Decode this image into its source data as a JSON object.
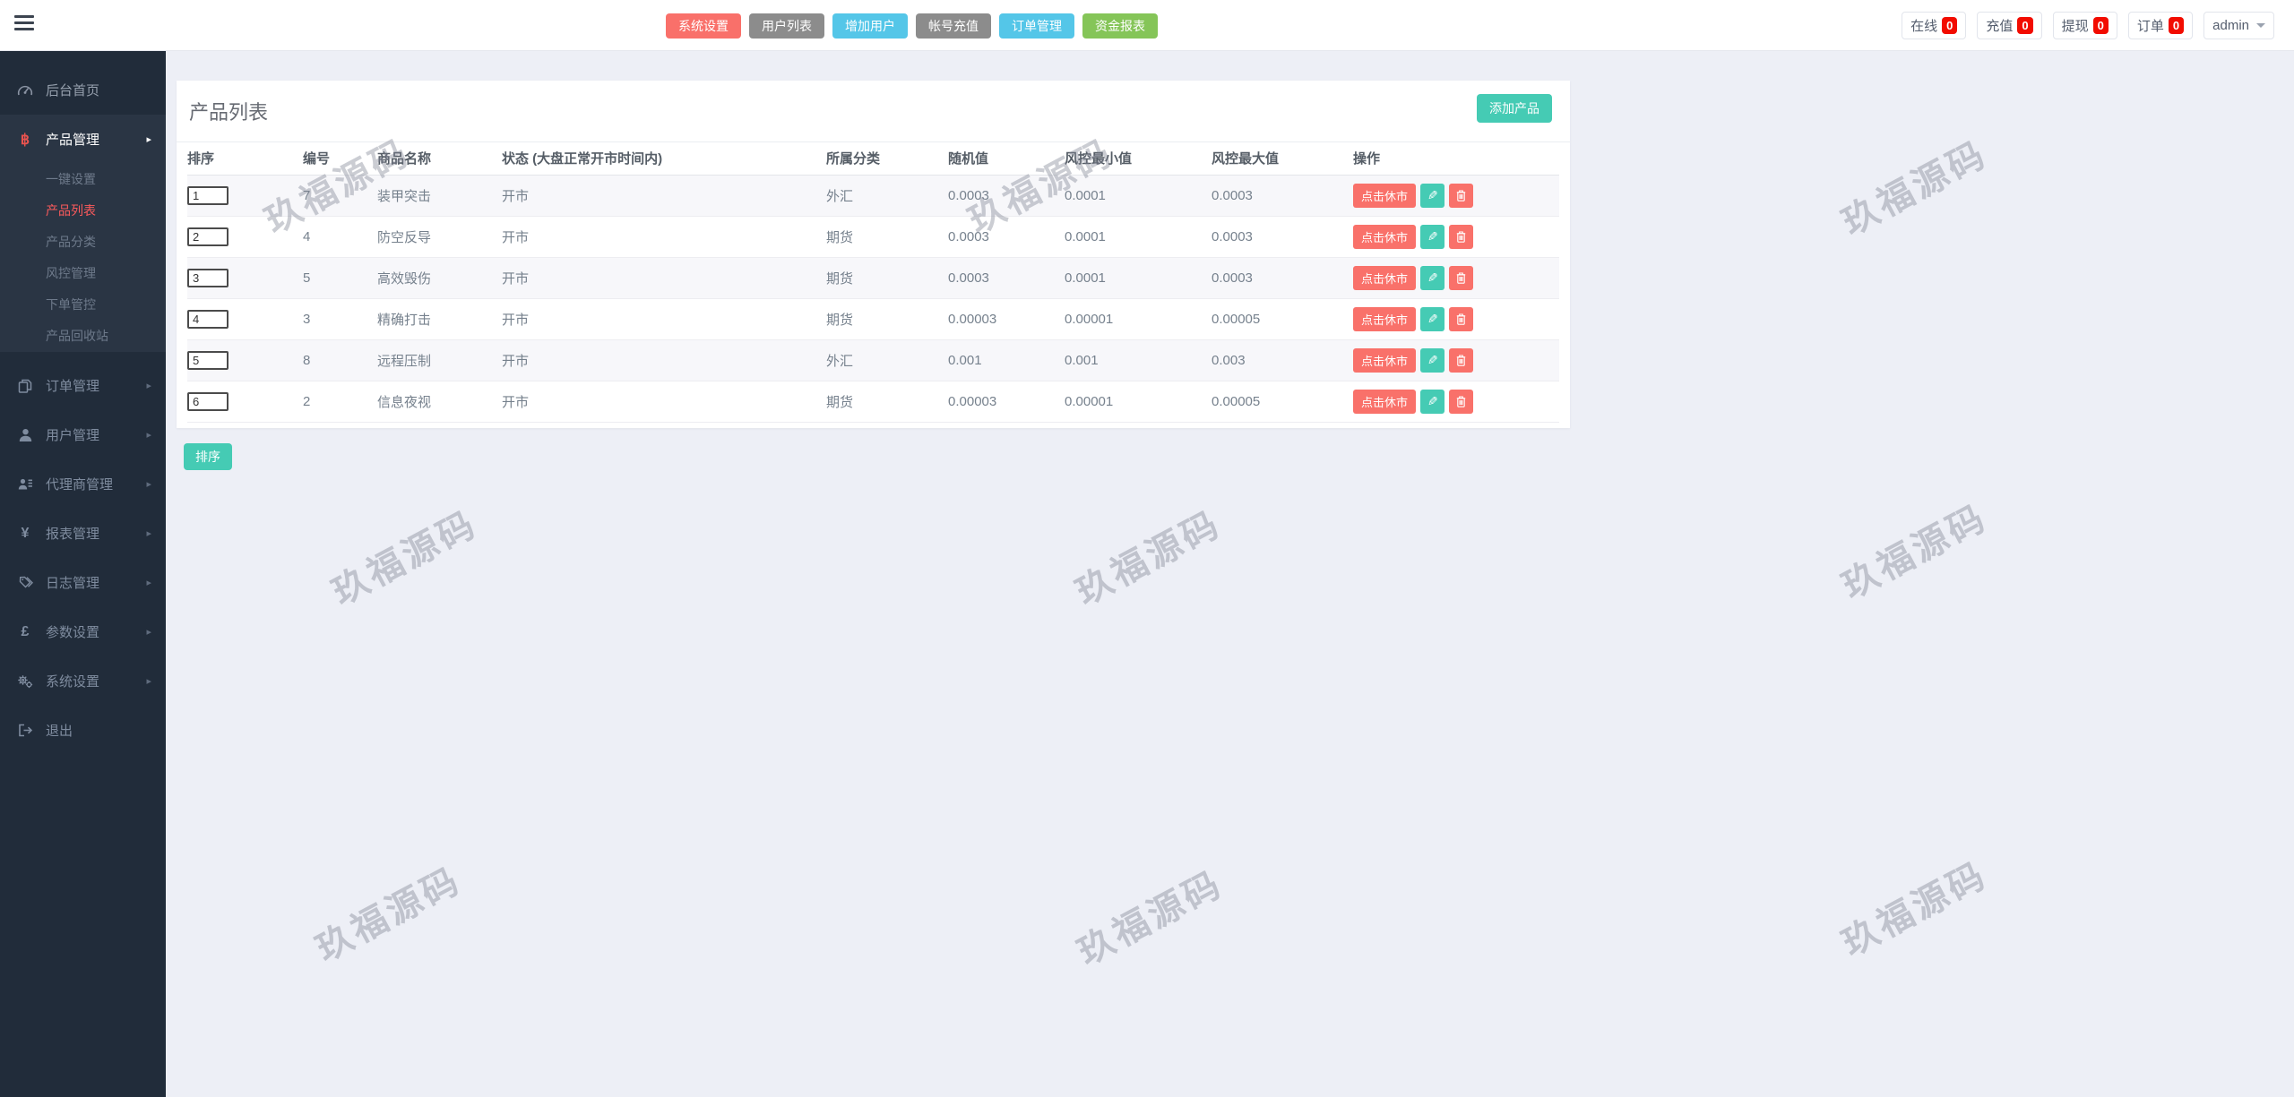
{
  "topbar": {
    "buttons": [
      {
        "label": "系统设置",
        "color": "#f9706a"
      },
      {
        "label": "用户列表",
        "color": "#8c8c8c"
      },
      {
        "label": "增加用户",
        "color": "#54c6e8"
      },
      {
        "label": "帐号充值",
        "color": "#8c8c8c"
      },
      {
        "label": "订单管理",
        "color": "#54c6e8"
      },
      {
        "label": "资金报表",
        "color": "#85c558"
      }
    ],
    "stats": [
      {
        "label": "在线",
        "value": "0"
      },
      {
        "label": "充值",
        "value": "0"
      },
      {
        "label": "提现",
        "value": "0"
      },
      {
        "label": "订单",
        "value": "0"
      }
    ],
    "user": "admin",
    "badge_color": "#f20c00"
  },
  "sidebar": {
    "home": "后台首页",
    "product_group": {
      "label": "产品管理",
      "children": [
        "一键设置",
        "产品列表",
        "产品分类",
        "风控管理",
        "下单管控",
        "产品回收站"
      ],
      "active_child": "产品列表"
    },
    "items": [
      "订单管理",
      "用户管理",
      "代理商管理",
      "报表管理",
      "日志管理",
      "参数设置",
      "系统设置"
    ],
    "logout": "退出"
  },
  "icons": {
    "bitcoin": "฿",
    "yen": "¥",
    "pound": "£",
    "pencil": "✎",
    "caret_right": "▸"
  },
  "panel": {
    "title": "产品列表",
    "add_button": "添加产品",
    "sort_button": "排序",
    "table": {
      "headers": [
        "排序",
        "编号",
        "商品名称",
        "状态 (大盘正常开市时间内)",
        "所属分类",
        "随机值",
        "风控最小值",
        "风控最大值",
        "操作"
      ],
      "action_button": "点击休市",
      "rows": [
        {
          "sort": "1",
          "id": "7",
          "name": "装甲突击",
          "status": "开市",
          "category": "外汇",
          "random": "0.0003",
          "risk_min": "0.0001",
          "risk_max": "0.0003"
        },
        {
          "sort": "2",
          "id": "4",
          "name": "防空反导",
          "status": "开市",
          "category": "期货",
          "random": "0.0003",
          "risk_min": "0.0001",
          "risk_max": "0.0003"
        },
        {
          "sort": "3",
          "id": "5",
          "name": "高效毁伤",
          "status": "开市",
          "category": "期货",
          "random": "0.0003",
          "risk_min": "0.0001",
          "risk_max": "0.0003"
        },
        {
          "sort": "4",
          "id": "3",
          "name": "精确打击",
          "status": "开市",
          "category": "期货",
          "random": "0.00003",
          "risk_min": "0.00001",
          "risk_max": "0.00005"
        },
        {
          "sort": "5",
          "id": "8",
          "name": "远程压制",
          "status": "开市",
          "category": "外汇",
          "random": "0.001",
          "risk_min": "0.001",
          "risk_max": "0.003"
        },
        {
          "sort": "6",
          "id": "2",
          "name": "信息夜视",
          "status": "开市",
          "category": "期货",
          "random": "0.00003",
          "risk_min": "0.00001",
          "risk_max": "0.00005"
        }
      ]
    }
  },
  "watermark": {
    "text": "玖福源码"
  },
  "colors": {
    "accent_teal": "#45cbb4",
    "accent_red": "#f9716a",
    "badge_red": "#f20c00",
    "sidebar_bg": "#212c3a",
    "sidebar_group_bg": "#2a3544",
    "active_item_red": "#fb5a5c",
    "page_bg": "#edeff6"
  }
}
